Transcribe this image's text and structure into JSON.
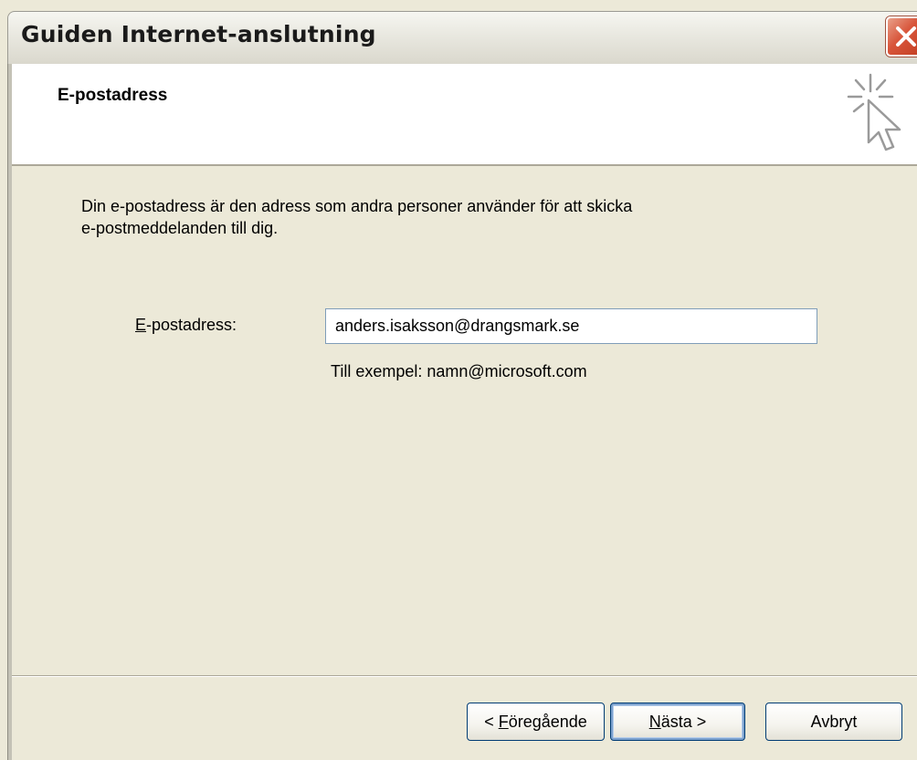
{
  "window": {
    "title": "Guiden Internet-anslutning"
  },
  "header": {
    "title": "E-postadress",
    "icon": "wizard-cursor-icon"
  },
  "content": {
    "description_line1": "Din e-postadress är den adress som andra personer använder för att skicka",
    "description_line2": "e-postmeddelanden till dig.",
    "field_label_accel": "E",
    "field_label_rest": "-postadress:",
    "email_value": "anders.isaksson@drangsmark.se",
    "example_text": "Till exempel: namn@microsoft.com"
  },
  "buttons": {
    "back_prefix": "< ",
    "back_accel": "F",
    "back_rest": "öregående",
    "next_accel": "N",
    "next_rest": "ästa >",
    "cancel_label": "Avbryt"
  },
  "colors": {
    "dialog_bg": "#ECE9D8",
    "close_button": "#D8553A",
    "input_border": "#7F9DB9",
    "default_button_focus": "#7DA2CE"
  }
}
